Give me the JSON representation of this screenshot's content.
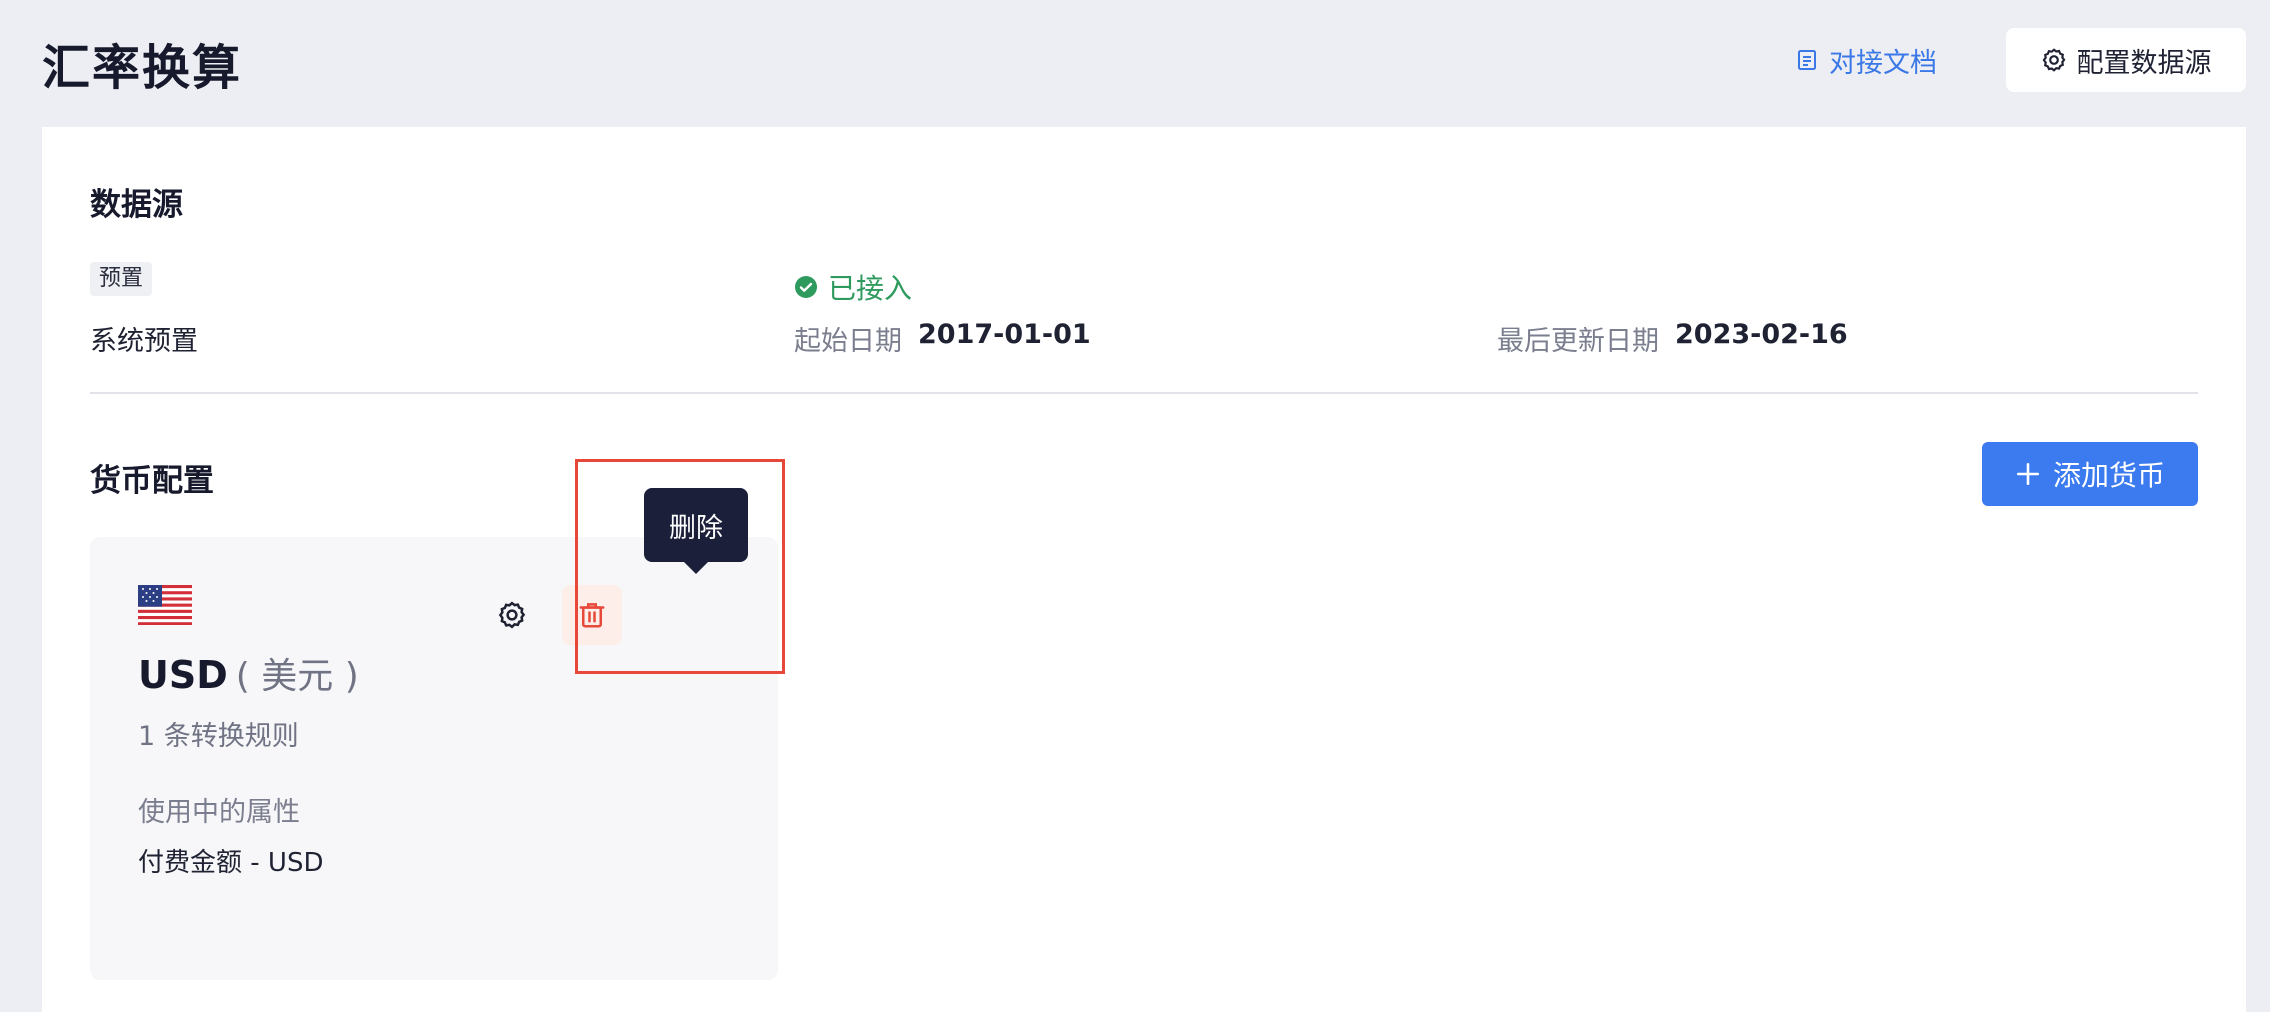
{
  "header": {
    "title": "汇率换算",
    "doc_link": "对接文档",
    "config_button": "配置数据源"
  },
  "data_source": {
    "section_title": "数据源",
    "tag": "预置",
    "name": "系统预置",
    "status": "已接入",
    "start_date_label": "起始日期",
    "start_date": "2017-01-01",
    "last_update_label": "最后更新日期",
    "last_update": "2023-02-16"
  },
  "currency_config": {
    "section_title": "货币配置",
    "add_button": "添加货币",
    "cards": [
      {
        "flag": "us-flag",
        "code": "USD",
        "name_cn": "( 美元 )",
        "rule_count": "1 条转换规则",
        "attr_label": "使用中的属性",
        "attr_value": "付费金额 - USD"
      }
    ]
  },
  "tooltip": {
    "text": "删除"
  },
  "colors": {
    "accent": "#3b7bef",
    "success": "#2e9a5d",
    "danger": "#e8483a",
    "tooltip_bg": "#1c1f3a"
  }
}
